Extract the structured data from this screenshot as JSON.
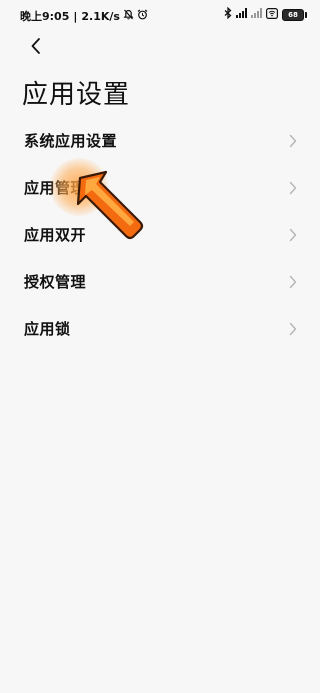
{
  "status_bar": {
    "time": "晚上9:05",
    "separator": "|",
    "network_speed": "2.1K/s",
    "left_icons": [
      "mute-bell-icon",
      "alarm-icon"
    ],
    "right_icons": [
      "bluetooth-icon",
      "signal-icon",
      "signal-icon",
      "wifi-icon"
    ],
    "battery": "68"
  },
  "header": {
    "back_icon": "chevron-left-icon",
    "title": "应用设置"
  },
  "settings": {
    "items": [
      {
        "label": "系统应用设置"
      },
      {
        "label": "应用管理"
      },
      {
        "label": "应用双开"
      },
      {
        "label": "授权管理"
      },
      {
        "label": "应用锁"
      }
    ]
  },
  "annotation": {
    "highlight_target": "应用管理",
    "arrow_color": "#f46a0f",
    "highlight_color": "#ffa040"
  }
}
